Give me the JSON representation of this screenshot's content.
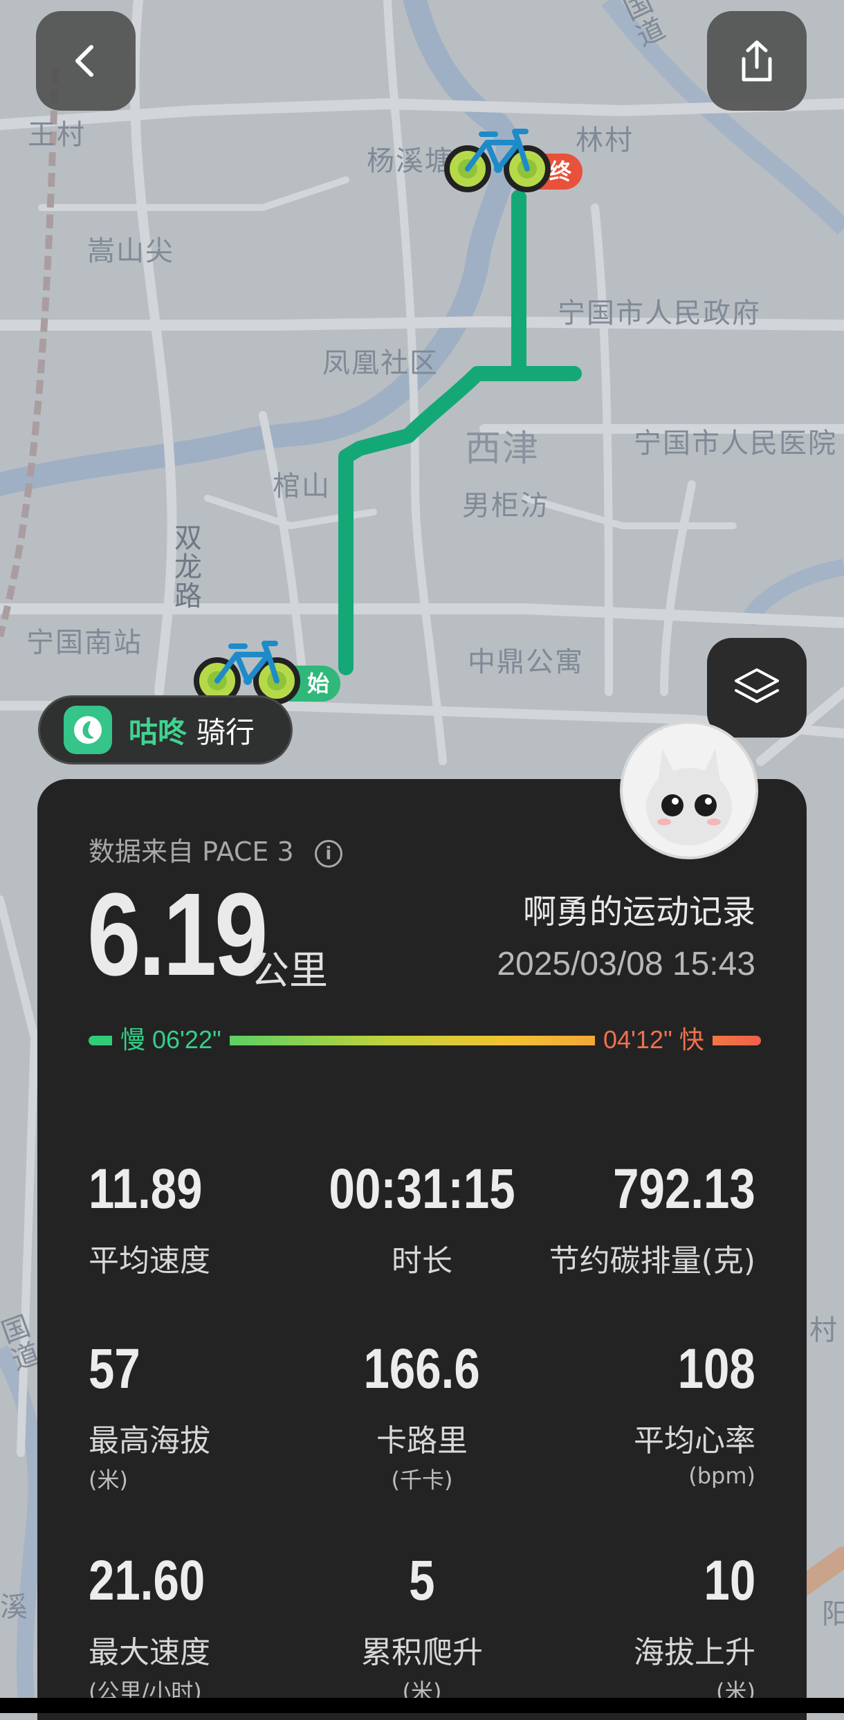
{
  "map": {
    "labels": {
      "wangcun": "王村",
      "songshanjian": "嵩山尖",
      "yangxitang": "杨溪塘",
      "lincun": "林村",
      "guodao": "国道",
      "gov": "宁国市人民政府",
      "fenghuang": "凤凰社区",
      "xijin": "西津",
      "hospital": "宁国市人民医院",
      "guanshan": "棺山",
      "nanjufang": "男柜汸",
      "shuanglonglu": "双龙路",
      "nanzhan": "宁国南站",
      "zhongding": "中鼎公寓",
      "guodao2": "国道",
      "xi": "溪",
      "cun": "村",
      "yang": "阳"
    },
    "start_label": "始",
    "end_label": "终",
    "route_color": "#14a877"
  },
  "badge": {
    "brand": "咕咚",
    "activity": "骑行"
  },
  "panel": {
    "source": "数据来自 PACE 3",
    "info_glyph": "i",
    "distance": "6.19",
    "distance_unit": "公里",
    "owner": "啊勇的运动记录",
    "datetime": "2025/03/08 15:43",
    "pace_slow": "慢 06'22\"",
    "pace_fast": "04'12\" 快",
    "stats": [
      {
        "value": "11.89",
        "label": "平均速度",
        "sub": ""
      },
      {
        "value": "00:31:15",
        "label": "时长",
        "sub": ""
      },
      {
        "value": "792.13",
        "label": "节约碳排量(克)",
        "sub": ""
      },
      {
        "value": "57",
        "label": "最高海拔",
        "sub": "(米)"
      },
      {
        "value": "166.6",
        "label": "卡路里",
        "sub": "(千卡)"
      },
      {
        "value": "108",
        "label": "平均心率",
        "sub": "(bpm)"
      },
      {
        "value": "21.60",
        "label": "最大速度",
        "sub": "(公里/小时)"
      },
      {
        "value": "5",
        "label": "累积爬升",
        "sub": "(米)"
      },
      {
        "value": "10",
        "label": "海拔上升",
        "sub": "(米)"
      }
    ]
  },
  "colors": {
    "panel_bg": "#232323",
    "accent_green": "#3fd48f",
    "pace_slow": "#34d08a",
    "pace_fast": "#f2704e",
    "end_marker": "#e8513a",
    "start_marker": "#2fb879"
  },
  "icons": {
    "back": "chevron-left-icon",
    "share": "share-icon",
    "layers": "layers-icon",
    "bike": "bicycle-icon",
    "info": "info-icon",
    "app_logo": "codoon-logo-icon"
  }
}
